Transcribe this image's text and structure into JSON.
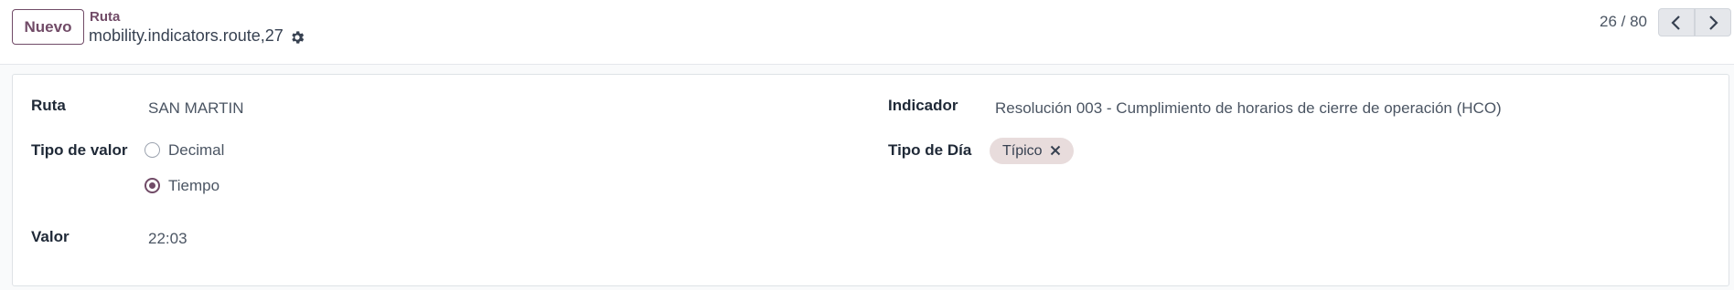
{
  "control_panel": {
    "new_button_label": "Nuevo",
    "breadcrumb_parent": "Ruta",
    "record_name": "mobility.indicators.route,27",
    "pager_value": "26 / 80"
  },
  "form": {
    "ruta": {
      "label": "Ruta",
      "value": "SAN MARTIN"
    },
    "tipo_valor": {
      "label": "Tipo de valor",
      "options": [
        {
          "label": "Decimal",
          "checked": false
        },
        {
          "label": "Tiempo",
          "checked": true
        }
      ]
    },
    "valor": {
      "label": "Valor",
      "value": "22:03"
    },
    "indicador": {
      "label": "Indicador",
      "value": "Resolución 003 - Cumplimiento de horarios de cierre de operación (HCO)"
    },
    "tipo_dia": {
      "label": "Tipo de Día",
      "tags": [
        "Típico"
      ]
    }
  },
  "colors": {
    "accent": "#714b67",
    "tag_bg": "#e8dcdc"
  },
  "icons": [
    "gear-icon",
    "chevron-left-icon",
    "chevron-right-icon",
    "close-icon"
  ]
}
